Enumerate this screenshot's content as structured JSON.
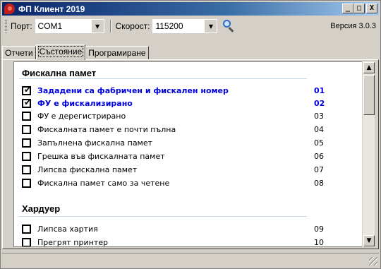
{
  "window": {
    "title": "ФП Клиент 2019"
  },
  "title_buttons": {
    "minimize": "_",
    "maximize": "□",
    "close": "X"
  },
  "toolbar": {
    "port_label": "Порт:",
    "port_value": "COM1",
    "speed_label": "Скорост:",
    "speed_value": "115200",
    "version": "Версия 3.0.3"
  },
  "tabs": [
    {
      "label": "Отчети"
    },
    {
      "label": "Състояние"
    },
    {
      "label": "Програмиране"
    }
  ],
  "sections": [
    {
      "title": "Фискална памет",
      "items": [
        {
          "label": "Зададени са фабричен и фискален номер",
          "code": "01",
          "checked": true
        },
        {
          "label": "ФУ е фискализирано",
          "code": "02",
          "checked": true
        },
        {
          "label": "ФУ е дерегистрирано",
          "code": "03",
          "checked": false
        },
        {
          "label": "Фискалната памет е почти пълна",
          "code": "04",
          "checked": false
        },
        {
          "label": "Запълнена фискална памет",
          "code": "05",
          "checked": false
        },
        {
          "label": "Грешка във фискалната памет",
          "code": "06",
          "checked": false
        },
        {
          "label": "Липсва фискална памет",
          "code": "07",
          "checked": false
        },
        {
          "label": "Фискална памет само за четене",
          "code": "08",
          "checked": false
        }
      ]
    },
    {
      "title": "Хардуер",
      "items": [
        {
          "label": "Липсва хартия",
          "code": "09",
          "checked": false
        },
        {
          "label": "Прегрят принтер",
          "code": "10",
          "checked": false
        }
      ]
    }
  ],
  "icons": {
    "app": "app-logo-icon",
    "search": "search-icon",
    "check": "✔"
  },
  "colors": {
    "titlebar": "#0a246a",
    "checked_text": "#0000dd",
    "window_bg": "#d4d0c8"
  }
}
